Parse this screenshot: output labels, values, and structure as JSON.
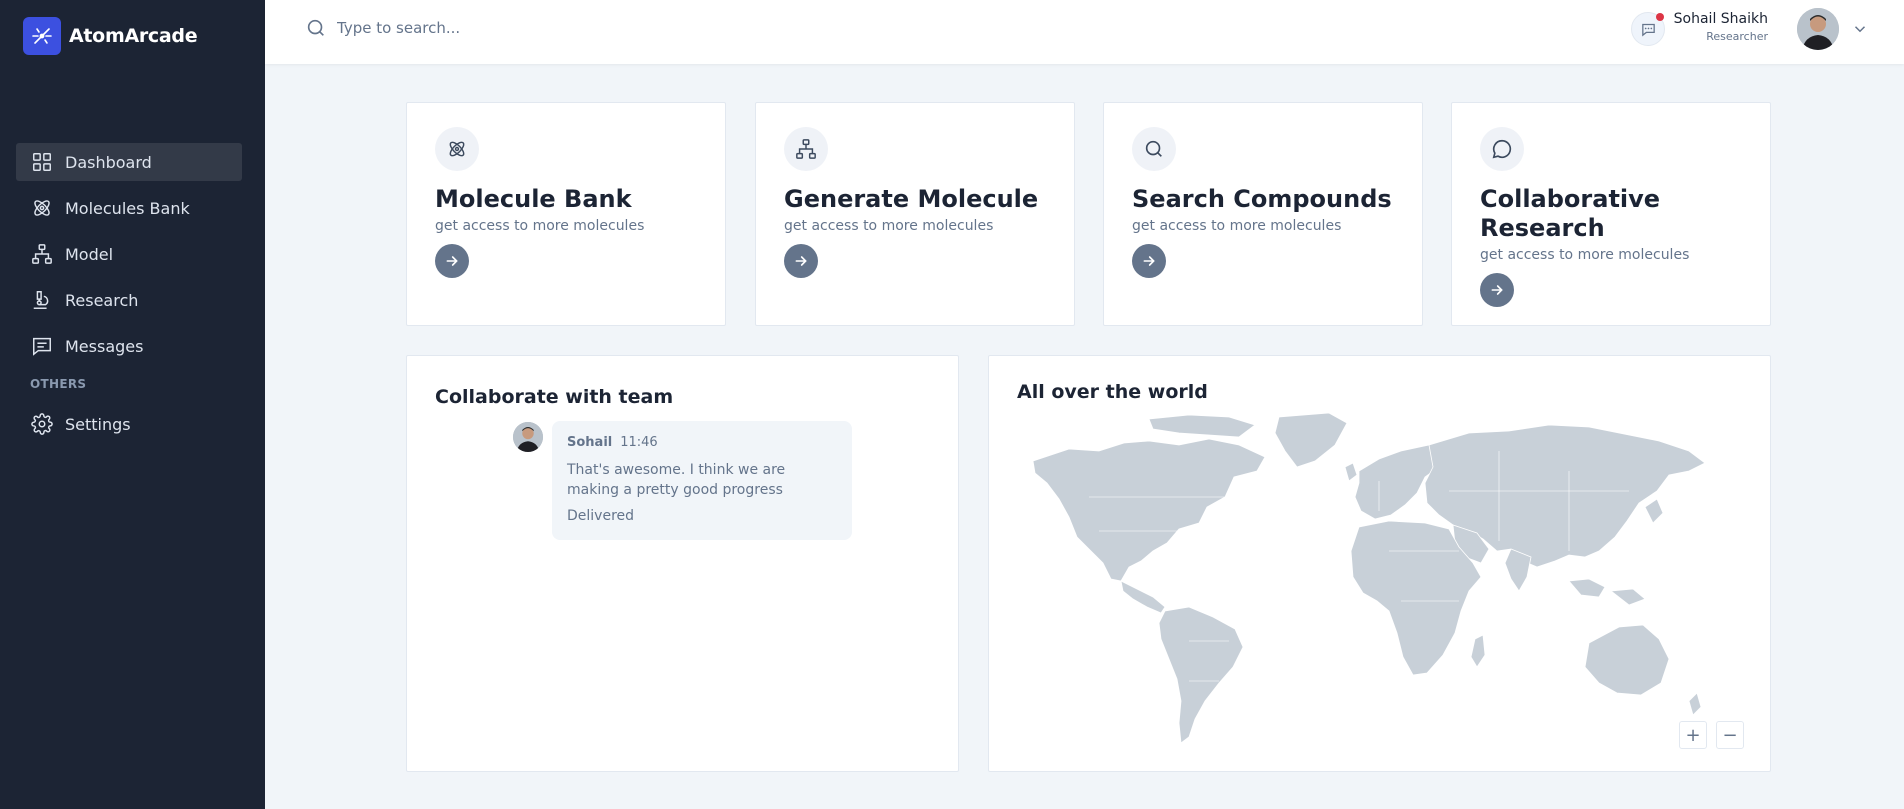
{
  "app": {
    "name": "AtomArcade"
  },
  "sidebar": {
    "items": [
      {
        "label": "Dashboard",
        "icon": "grid-icon",
        "active": true
      },
      {
        "label": "Molecules Bank",
        "icon": "atom-icon"
      },
      {
        "label": "Model",
        "icon": "sitemap-icon"
      },
      {
        "label": "Research",
        "icon": "microscope-icon"
      },
      {
        "label": "Messages",
        "icon": "message-square-icon"
      }
    ],
    "others_heading": "OTHERS",
    "settings_label": "Settings"
  },
  "header": {
    "search_placeholder": "Type to search...",
    "user_name": "Sohail Shaikh",
    "user_role": "Researcher"
  },
  "features": [
    {
      "title": "Molecule Bank",
      "subtitle": "get access to more molecules",
      "icon": "atom-icon"
    },
    {
      "title": "Generate Molecule",
      "subtitle": "get access to more molecules",
      "icon": "sitemap-icon"
    },
    {
      "title": "Search Compounds",
      "subtitle": "get access to more molecules",
      "icon": "search-icon"
    },
    {
      "title": "Collaborative Research",
      "subtitle": "get access to more molecules",
      "icon": "chat-bubble-icon"
    }
  ],
  "collaborate": {
    "title": "Collaborate with team",
    "message": {
      "author": "Sohail",
      "time": "11:46",
      "text": "That's awesome. I think we are making a pretty good progress",
      "status": "Delivered"
    }
  },
  "world": {
    "title": "All over the world",
    "zoom_in": "+",
    "zoom_out": "−"
  },
  "colors": {
    "sidebar_bg": "#1c2434",
    "brand_accent": "#3c50e0",
    "notification_dot": "#dc3545",
    "map_land": "#c8d0d8"
  }
}
